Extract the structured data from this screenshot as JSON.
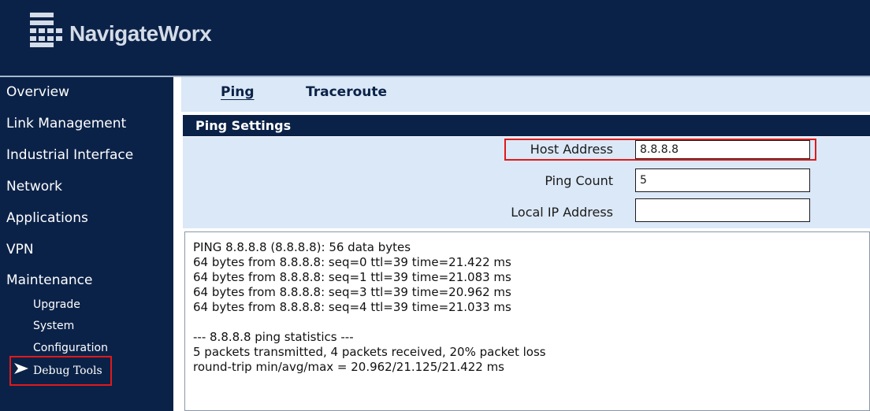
{
  "header": {
    "brand": "NavigateWorx",
    "logo_icon": "navigateworx-logo-icon"
  },
  "colors": {
    "navy": "#0b2248",
    "light_panel": "#dbe8f7",
    "highlight_red": "#e11919",
    "text_light": "#d4dce8"
  },
  "sidebar": {
    "items": [
      {
        "label": "Overview"
      },
      {
        "label": "Link Management"
      },
      {
        "label": "Industrial Interface"
      },
      {
        "label": "Network"
      },
      {
        "label": "Applications"
      },
      {
        "label": "VPN"
      },
      {
        "label": "Maintenance"
      }
    ],
    "sub_items": [
      {
        "label": "Upgrade"
      },
      {
        "label": "System"
      },
      {
        "label": "Configuration"
      },
      {
        "label": "Debug Tools",
        "active": true,
        "icon": "arrow-right-icon"
      }
    ]
  },
  "tabs": [
    {
      "label": "Ping",
      "active": true
    },
    {
      "label": "Traceroute",
      "active": false
    }
  ],
  "ping_settings": {
    "title": "Ping Settings",
    "host_address": {
      "label": "Host Address",
      "value": "8.8.8.8"
    },
    "ping_count": {
      "label": "Ping Count",
      "value": "5"
    },
    "local_ip": {
      "label": "Local IP Address",
      "value": ""
    }
  },
  "output": {
    "lines": [
      "PING 8.8.8.8 (8.8.8.8): 56 data bytes",
      "64 bytes from 8.8.8.8: seq=0 ttl=39 time=21.422 ms",
      "64 bytes from 8.8.8.8: seq=1 ttl=39 time=21.083 ms",
      "64 bytes from 8.8.8.8: seq=3 ttl=39 time=20.962 ms",
      "64 bytes from 8.8.8.8: seq=4 ttl=39 time=21.033 ms",
      "",
      "--- 8.8.8.8 ping statistics ---",
      "5 packets transmitted, 4 packets received, 20% packet loss",
      "round-trip min/avg/max = 20.962/21.125/21.422 ms"
    ]
  }
}
